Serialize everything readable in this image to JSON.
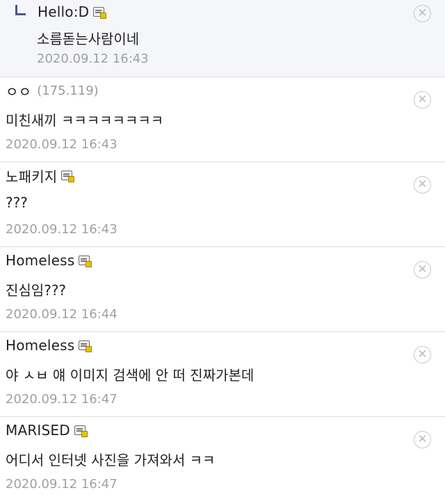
{
  "comments": [
    {
      "type": "reply",
      "nick": "Hello:D",
      "ip": "",
      "has_gallog_icon": true,
      "text": "소름돋는사람이네",
      "date": "2020.09.12 16:43"
    },
    {
      "type": "normal",
      "nick": "ㅇㅇ",
      "ip": "(175.119)",
      "has_gallog_icon": false,
      "text": "미친새끼 ㅋㅋㅋㅋㅋㅋㅋㅋ",
      "date": "2020.09.12 16:43"
    },
    {
      "type": "normal",
      "nick": "노패키지",
      "ip": "",
      "has_gallog_icon": true,
      "text": "???",
      "date": "2020.09.12 16:43"
    },
    {
      "type": "normal",
      "nick": "Homeless",
      "ip": "",
      "has_gallog_icon": true,
      "text": "진심임???",
      "date": "2020.09.12 16:44"
    },
    {
      "type": "normal",
      "nick": "Homeless",
      "ip": "",
      "has_gallog_icon": true,
      "text": "야 ㅅㅂ 얘 이미지 검색에 안 떠 진짜가본데",
      "date": "2020.09.12 16:47"
    },
    {
      "type": "normal",
      "nick": "MARISED",
      "ip": "",
      "has_gallog_icon": true,
      "text": "어디서 인터넷 사진을 가져와서 ㅋㅋ",
      "date": "2020.09.12 16:47"
    }
  ],
  "icons": {
    "delete": "close-circle-icon",
    "gallog": "gallog-icon",
    "reply": "reply-arrow-icon"
  },
  "colors": {
    "reply_background": "#f5f6f9",
    "reply_arrow": "#4a5590",
    "date_text": "#a0a0a0",
    "divider": "#dcdcdc"
  }
}
